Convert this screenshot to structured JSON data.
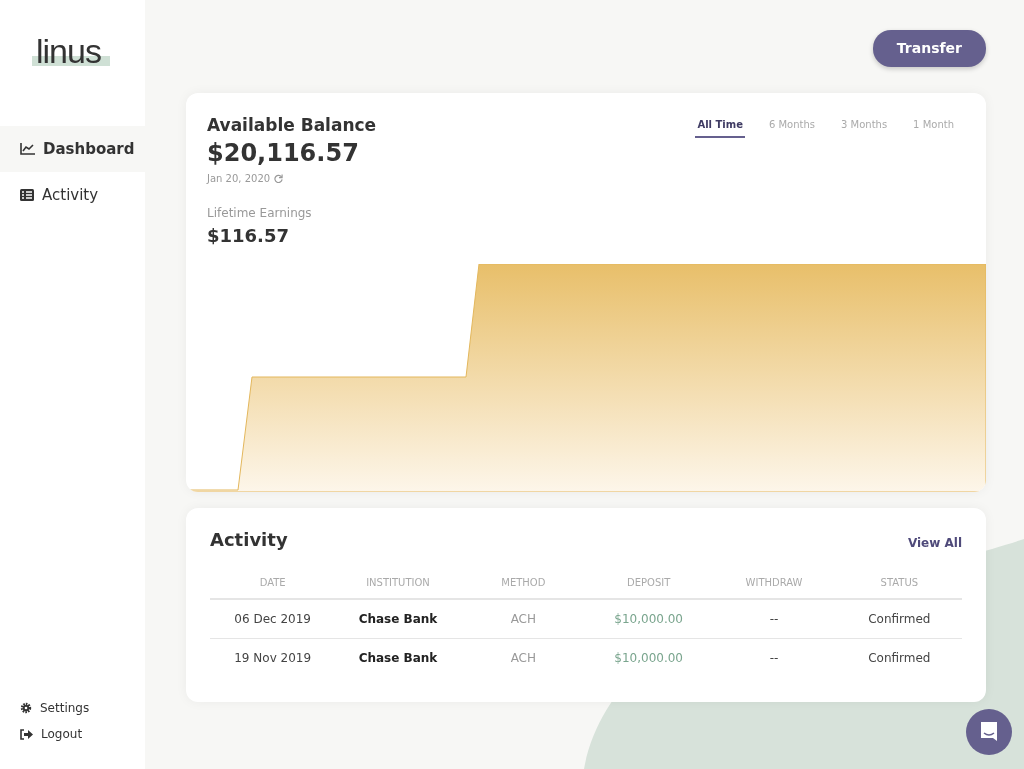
{
  "sidebar": {
    "logo": "linus",
    "items": [
      {
        "label": "Dashboard",
        "selected": true
      },
      {
        "label": "Activity",
        "selected": false
      }
    ],
    "footer_items": [
      {
        "label": "Settings"
      },
      {
        "label": "Logout"
      }
    ]
  },
  "header": {
    "button": "Transfer"
  },
  "balance": {
    "title": "Available Balance",
    "amount": "$20,116.57",
    "date": "Jan 20, 2020",
    "earnings_label": "Lifetime Earnings",
    "earnings": "$116.57",
    "ranges": [
      {
        "label": "All Time",
        "selected": true
      },
      {
        "label": "6 Months",
        "selected": false
      },
      {
        "label": "3 Months",
        "selected": false
      },
      {
        "label": "1 Month",
        "selected": false
      }
    ]
  },
  "activity": {
    "title": "Activity",
    "link": "View All",
    "columns": [
      "DATE",
      "INSTITUTION",
      "METHOD",
      "DEPOSIT",
      "WITHDRAW",
      "STATUS"
    ],
    "rows": [
      [
        "06 Dec 2019",
        "Chase Bank",
        "ACH",
        "$10,000.00",
        "--",
        "Confirmed"
      ],
      [
        "19 Nov 2019",
        "Chase Bank",
        "ACH",
        "$10,000.00",
        "--",
        "Confirmed"
      ]
    ]
  }
}
